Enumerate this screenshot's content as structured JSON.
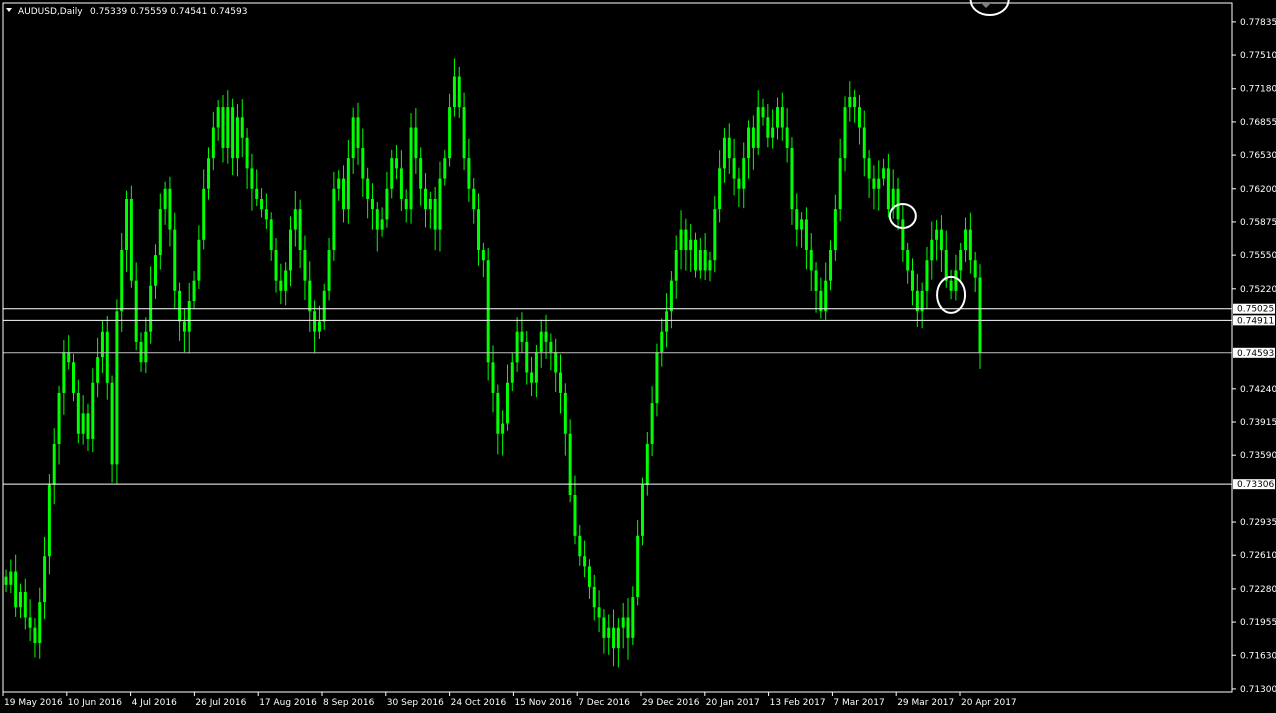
{
  "header": {
    "symbol": "AUDUSD,Daily",
    "ohlc": "0.75339 0.75559 0.74541 0.74593"
  },
  "colors": {
    "background": "#000000",
    "candle": "#00ff00",
    "axis": "#ffffff",
    "level_line": "#ffffff",
    "price_line": "#c0c0c0"
  },
  "chart_data": {
    "type": "bar",
    "ylim": [
      0.7127,
      0.7802
    ],
    "y_ticks": [
      "0.77835",
      "0.77510",
      "0.77180",
      "0.76855",
      "0.76530",
      "0.76200",
      "0.75875",
      "0.75550",
      "0.75220",
      "0.74240",
      "0.73915",
      "0.73590",
      "0.72935",
      "0.72610",
      "0.72280",
      "0.71955",
      "0.71630",
      "0.71300"
    ],
    "x_ticks": [
      "19 May 2016",
      "10 Jun 2016",
      "4 Jul 2016",
      "26 Jul 2016",
      "17 Aug 2016",
      "8 Sep 2016",
      "30 Sep 2016",
      "24 Oct 2016",
      "15 Nov 2016",
      "7 Dec 2016",
      "29 Dec 2016",
      "20 Jan 2017",
      "13 Feb 2017",
      "7 Mar 2017",
      "29 Mar 2017",
      "20 Apr 2017"
    ],
    "levels": [
      {
        "value": 0.75025,
        "label": "0.75025"
      },
      {
        "value": 0.74911,
        "label": "0.74911"
      },
      {
        "value": 0.73306,
        "label": "0.73306"
      }
    ],
    "current_price": {
      "value": 0.74593,
      "label": "0.74593"
    },
    "closes": [
      0.7232,
      0.7245,
      0.721,
      0.7225,
      0.72,
      0.719,
      0.7175,
      0.7215,
      0.726,
      0.733,
      0.737,
      0.742,
      0.746,
      0.745,
      0.742,
      0.738,
      0.74,
      0.7375,
      0.743,
      0.7455,
      0.748,
      0.743,
      0.735,
      0.75,
      0.756,
      0.761,
      0.753,
      0.747,
      0.745,
      0.748,
      0.7525,
      0.7555,
      0.76,
      0.762,
      0.758,
      0.752,
      0.749,
      0.748,
      0.751,
      0.753,
      0.757,
      0.762,
      0.765,
      0.768,
      0.77,
      0.766,
      0.77,
      0.765,
      0.769,
      0.767,
      0.764,
      0.762,
      0.761,
      0.76,
      0.759,
      0.756,
      0.753,
      0.752,
      0.754,
      0.758,
      0.76,
      0.756,
      0.753,
      0.75,
      0.748,
      0.749,
      0.752,
      0.756,
      0.762,
      0.763,
      0.76,
      0.765,
      0.769,
      0.766,
      0.763,
      0.761,
      0.76,
      0.758,
      0.759,
      0.762,
      0.765,
      0.764,
      0.761,
      0.76,
      0.768,
      0.765,
      0.762,
      0.76,
      0.761,
      0.758,
      0.763,
      0.765,
      0.77,
      0.773,
      0.77,
      0.765,
      0.762,
      0.76,
      0.756,
      0.755,
      0.745,
      0.742,
      0.738,
      0.739,
      0.743,
      0.745,
      0.748,
      0.747,
      0.744,
      0.743,
      0.746,
      0.748,
      0.747,
      0.746,
      0.744,
      0.742,
      0.738,
      0.732,
      0.728,
      0.726,
      0.725,
      0.723,
      0.721,
      0.72,
      0.718,
      0.719,
      0.717,
      0.719,
      0.72,
      0.718,
      0.722,
      0.728,
      0.733,
      0.737,
      0.741,
      0.746,
      0.748,
      0.75,
      0.753,
      0.756,
      0.758,
      0.756,
      0.757,
      0.754,
      0.756,
      0.754,
      0.755,
      0.76,
      0.764,
      0.767,
      0.765,
      0.763,
      0.762,
      0.765,
      0.768,
      0.766,
      0.77,
      0.769,
      0.767,
      0.768,
      0.77,
      0.768,
      0.766,
      0.76,
      0.758,
      0.759,
      0.756,
      0.754,
      0.752,
      0.75,
      0.753,
      0.756,
      0.76,
      0.765,
      0.77,
      0.771,
      0.77,
      0.768,
      0.765,
      0.763,
      0.762,
      0.763,
      0.764,
      0.76,
      0.762,
      0.759,
      0.756,
      0.754,
      0.752,
      0.75,
      0.752,
      0.755,
      0.757,
      0.758,
      0.756,
      0.753,
      0.752,
      0.754,
      0.756,
      0.758,
      0.755,
      0.7533,
      0.7459
    ],
    "marked_points": [
      {
        "index": 186,
        "label": ""
      },
      {
        "index": 204,
        "label": ""
      },
      {
        "index": 196,
        "label": ""
      }
    ]
  }
}
